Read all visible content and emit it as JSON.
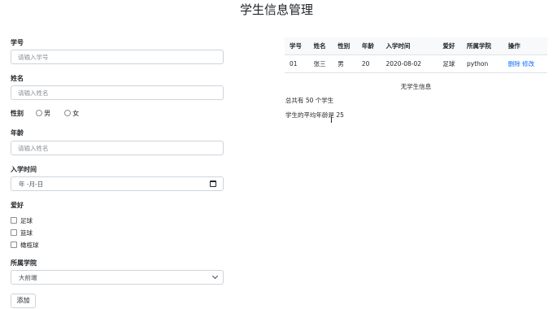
{
  "page": {
    "title": "学生信息管理"
  },
  "form": {
    "student_id": {
      "label": "学号",
      "placeholder": "请输入学号"
    },
    "name": {
      "label": "姓名",
      "placeholder": "请输入姓名"
    },
    "gender": {
      "label": "性别",
      "options": [
        "男",
        "女"
      ]
    },
    "age": {
      "label": "年龄",
      "placeholder": "请输入姓名"
    },
    "enroll_time": {
      "label": "入学时间",
      "value": "年 -月-日"
    },
    "hobbies": {
      "label": "爱好",
      "options": [
        "足球",
        "篮球",
        "橄榄球"
      ]
    },
    "college": {
      "label": "所属学院",
      "selected": "大前端"
    },
    "submit_label": "添加"
  },
  "table": {
    "headers": [
      "学号",
      "姓名",
      "性别",
      "年龄",
      "入学时间",
      "爱好",
      "所属学院",
      "操作"
    ],
    "rows": [
      {
        "id": "01",
        "name": "张三",
        "gender": "男",
        "age": "20",
        "enroll": "2020-08-02",
        "hobby": "足球",
        "college": "python",
        "delete": "删除",
        "edit": "修改"
      }
    ],
    "empty_text": "无学生信息"
  },
  "summary": {
    "total": "总共有 50 个学生",
    "average": "学生的平均年龄是 25"
  },
  "cursor_glyph": "I"
}
